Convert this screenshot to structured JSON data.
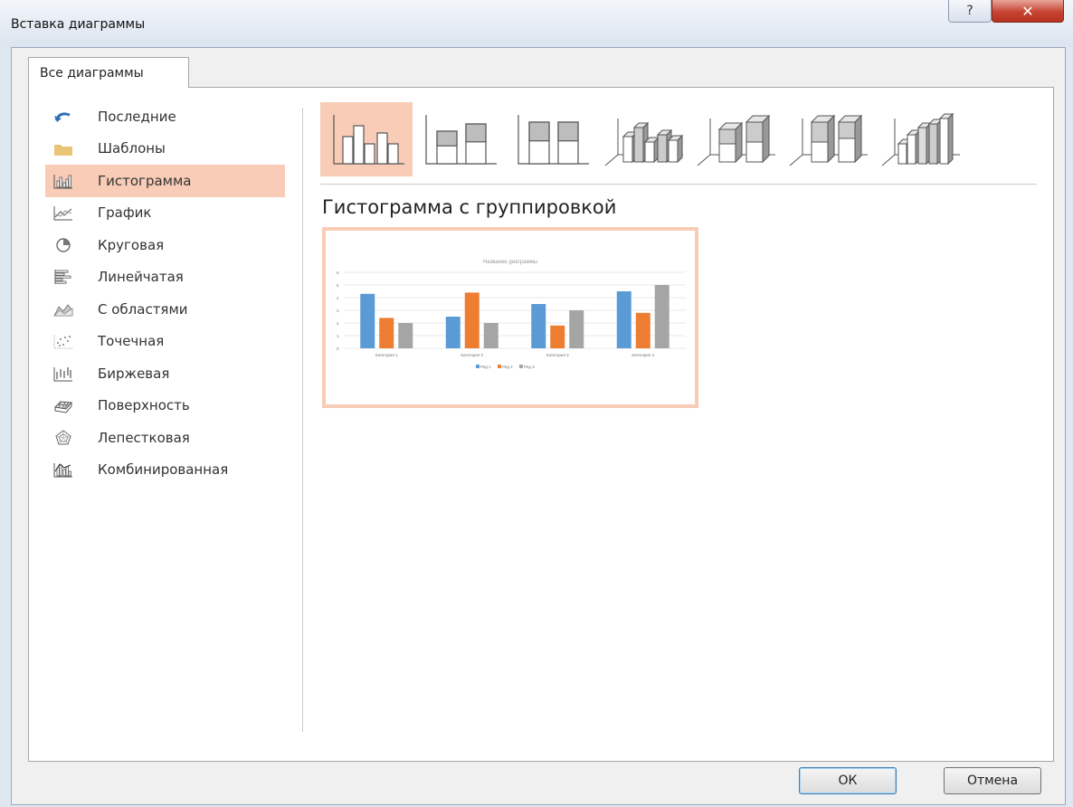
{
  "window": {
    "title": "Вставка диаграммы",
    "help_glyph": "?",
    "close_glyph": "✕"
  },
  "tabs": [
    {
      "label": "Все диаграммы"
    }
  ],
  "categories": [
    {
      "label": "Последние",
      "icon": "recent-arrow-icon"
    },
    {
      "label": "Шаблоны",
      "icon": "folder-icon"
    },
    {
      "label": "Гистограмма",
      "icon": "column-chart-icon",
      "selected": true
    },
    {
      "label": "График",
      "icon": "line-chart-icon"
    },
    {
      "label": "Круговая",
      "icon": "pie-chart-icon"
    },
    {
      "label": "Линейчатая",
      "icon": "bar-chart-icon"
    },
    {
      "label": "С областями",
      "icon": "area-chart-icon"
    },
    {
      "label": "Точечная",
      "icon": "scatter-chart-icon"
    },
    {
      "label": "Биржевая",
      "icon": "stock-chart-icon"
    },
    {
      "label": "Поверхность",
      "icon": "surface-chart-icon"
    },
    {
      "label": "Лепестковая",
      "icon": "radar-chart-icon"
    },
    {
      "label": "Комбинированная",
      "icon": "combo-chart-icon"
    }
  ],
  "subtypes": {
    "selected_index": 0,
    "items": [
      {
        "icon": "clustered-column-icon"
      },
      {
        "icon": "stacked-column-icon"
      },
      {
        "icon": "stacked-100-column-icon"
      },
      {
        "icon": "3d-clustered-column-icon"
      },
      {
        "icon": "3d-stacked-column-icon"
      },
      {
        "icon": "3d-stacked-100-column-icon"
      },
      {
        "icon": "3d-column-icon"
      }
    ],
    "selected_title": "Гистограмма с группировкой"
  },
  "preview": {
    "chart_title": "Название диаграммы",
    "y_ticks": [
      "6",
      "5",
      "4",
      "3",
      "2",
      "1",
      "0"
    ],
    "categories": [
      "Категория 1",
      "Категория 2",
      "Категория 3",
      "Категория 4"
    ],
    "series": [
      {
        "name": "Ряд 1",
        "color": "#5b9bd5",
        "values": [
          4.3,
          2.5,
          3.5,
          4.5
        ]
      },
      {
        "name": "Ряд 2",
        "color": "#ed7d31",
        "values": [
          2.4,
          4.4,
          1.8,
          2.8
        ]
      },
      {
        "name": "Ряд 3",
        "color": "#a5a5a5",
        "values": [
          2.0,
          2.0,
          3.0,
          5.0
        ]
      }
    ],
    "ymax": 6
  },
  "buttons": {
    "ok": "ОК",
    "cancel": "Отмена"
  }
}
